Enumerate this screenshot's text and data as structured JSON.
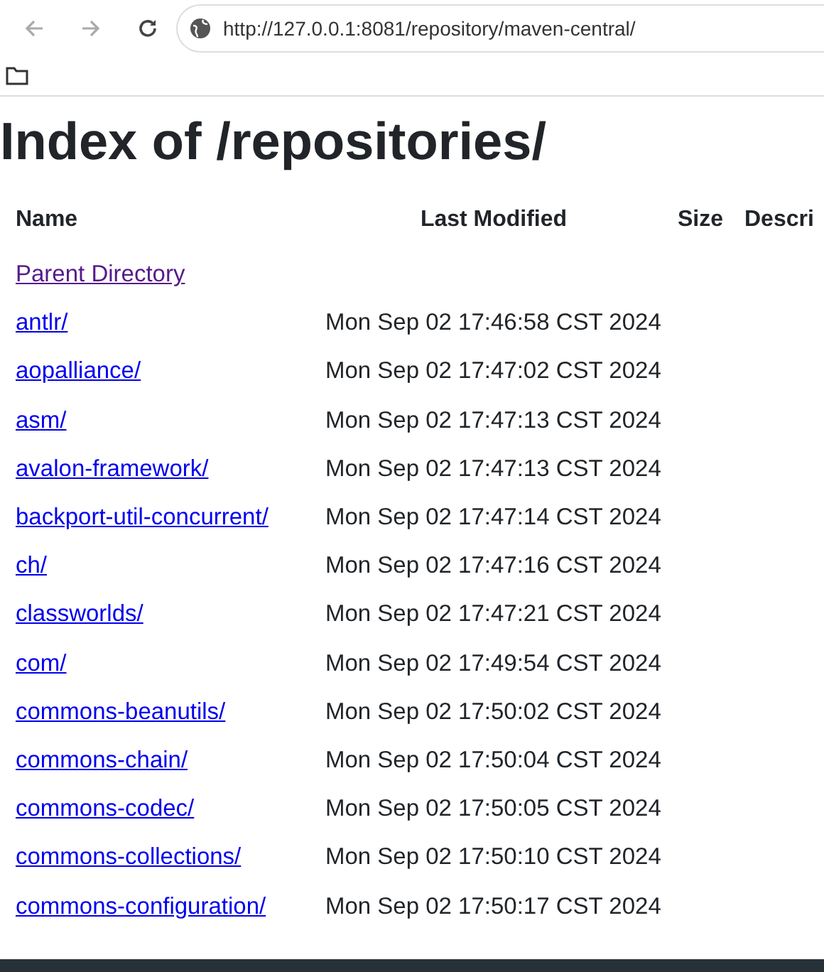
{
  "browser": {
    "url": "http://127.0.0.1:8081/repository/maven-central/"
  },
  "heading": "Index of /repositories/",
  "table": {
    "columns": [
      "Name",
      "Last Modified",
      "Size",
      "Descri"
    ],
    "rows": [
      {
        "name": "Parent Directory",
        "modified": "",
        "visited": true
      },
      {
        "name": "antlr/",
        "modified": "Mon Sep 02 17:46:58 CST 2024",
        "visited": false
      },
      {
        "name": "aopalliance/",
        "modified": "Mon Sep 02 17:47:02 CST 2024",
        "visited": false
      },
      {
        "name": "asm/",
        "modified": "Mon Sep 02 17:47:13 CST 2024",
        "visited": false
      },
      {
        "name": "avalon-framework/",
        "modified": "Mon Sep 02 17:47:13 CST 2024",
        "visited": false
      },
      {
        "name": "backport-util-concurrent/",
        "modified": "Mon Sep 02 17:47:14 CST 2024",
        "visited": false
      },
      {
        "name": "ch/",
        "modified": "Mon Sep 02 17:47:16 CST 2024",
        "visited": false
      },
      {
        "name": "classworlds/",
        "modified": "Mon Sep 02 17:47:21 CST 2024",
        "visited": false
      },
      {
        "name": "com/",
        "modified": "Mon Sep 02 17:49:54 CST 2024",
        "visited": false
      },
      {
        "name": "commons-beanutils/",
        "modified": "Mon Sep 02 17:50:02 CST 2024",
        "visited": false
      },
      {
        "name": "commons-chain/",
        "modified": "Mon Sep 02 17:50:04 CST 2024",
        "visited": false
      },
      {
        "name": "commons-codec/",
        "modified": "Mon Sep 02 17:50:05 CST 2024",
        "visited": false
      },
      {
        "name": "commons-collections/",
        "modified": "Mon Sep 02 17:50:10 CST 2024",
        "visited": false
      },
      {
        "name": "commons-configuration/",
        "modified": "Mon Sep 02 17:50:17 CST 2024",
        "visited": false
      }
    ]
  }
}
